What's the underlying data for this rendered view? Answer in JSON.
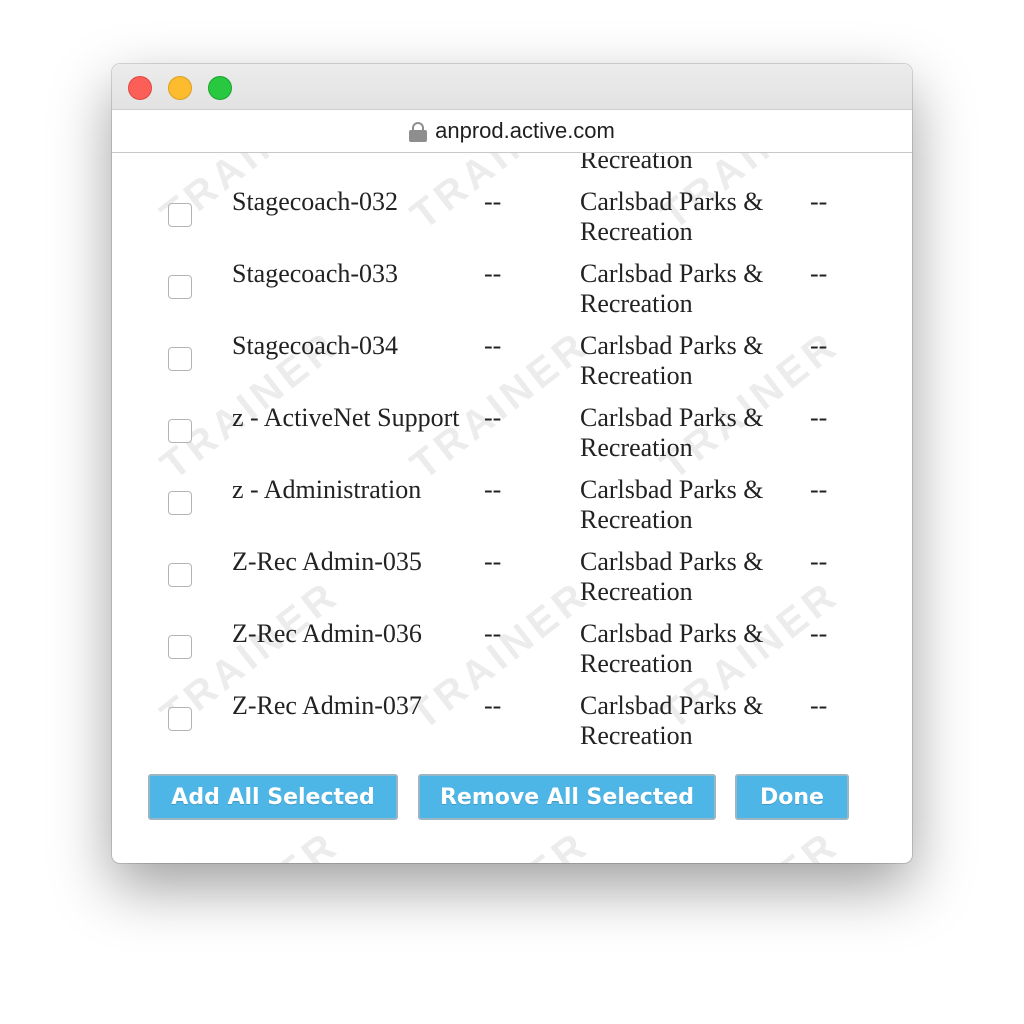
{
  "browser": {
    "url": "anprod.active.com",
    "lock_icon": "lock-icon"
  },
  "watermark": "TRAINER",
  "partial_row": {
    "agency_line2": "Recreation"
  },
  "rows": [
    {
      "name": "Stagecoach-032",
      "col2": "--",
      "agency": "Carlsbad Parks & Recreation",
      "col4": "--"
    },
    {
      "name": "Stagecoach-033",
      "col2": "--",
      "agency": "Carlsbad Parks & Recreation",
      "col4": "--"
    },
    {
      "name": "Stagecoach-034",
      "col2": "--",
      "agency": "Carlsbad Parks & Recreation",
      "col4": "--"
    },
    {
      "name": "z - ActiveNet Support",
      "col2": "--",
      "agency": "Carlsbad Parks & Recreation",
      "col4": "--"
    },
    {
      "name": "z - Administration",
      "col2": "--",
      "agency": "Carlsbad Parks & Recreation",
      "col4": "--"
    },
    {
      "name": "Z-Rec Admin-035",
      "col2": "--",
      "agency": "Carlsbad Parks & Recreation",
      "col4": "--"
    },
    {
      "name": "Z-Rec Admin-036",
      "col2": "--",
      "agency": "Carlsbad Parks & Recreation",
      "col4": "--"
    },
    {
      "name": "Z-Rec Admin-037",
      "col2": "--",
      "agency": "Carlsbad Parks & Recreation",
      "col4": "--"
    }
  ],
  "buttons": {
    "add_all": "Add All Selected",
    "remove_all": "Remove All Selected",
    "done": "Done"
  },
  "colors": {
    "button_bg": "#4db6e6",
    "close": "#fc5f57",
    "minimize": "#fdbc2e",
    "zoom": "#28c840"
  }
}
